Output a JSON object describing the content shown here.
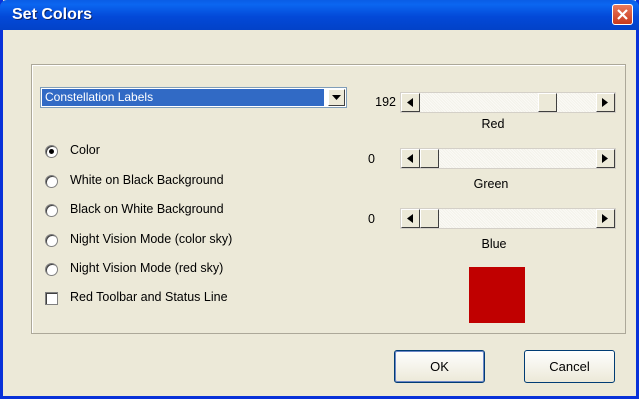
{
  "window": {
    "title": "Set Colors"
  },
  "object_select": {
    "selected": "Constellation Labels"
  },
  "radio_options": [
    {
      "label": "Color",
      "checked": true
    },
    {
      "label": "White on Black Background",
      "checked": false
    },
    {
      "label": "Black on White Background",
      "checked": false
    },
    {
      "label": "Night Vision Mode (color sky)",
      "checked": false
    },
    {
      "label": "Night Vision Mode (red sky)",
      "checked": false
    }
  ],
  "checkbox": {
    "label": "Red Toolbar and Status Line",
    "checked": false
  },
  "sliders": {
    "red": {
      "value": "192",
      "label": "Red",
      "max": 255
    },
    "green": {
      "value": "0",
      "label": "Green",
      "max": 255
    },
    "blue": {
      "value": "0",
      "label": "Blue",
      "max": 255
    }
  },
  "preview": {
    "color": "#c00000"
  },
  "buttons": {
    "ok": "OK",
    "cancel": "Cancel"
  },
  "icons": {
    "close": "close-icon",
    "dropdown": "chevron-down-icon",
    "scroll_left": "arrow-left-icon",
    "scroll_right": "arrow-right-icon"
  },
  "colors": {
    "title_bar": "#0349d8",
    "dialog_bg": "#ece9d8",
    "selection": "#316ac5",
    "preview_swatch": "#c00000"
  }
}
